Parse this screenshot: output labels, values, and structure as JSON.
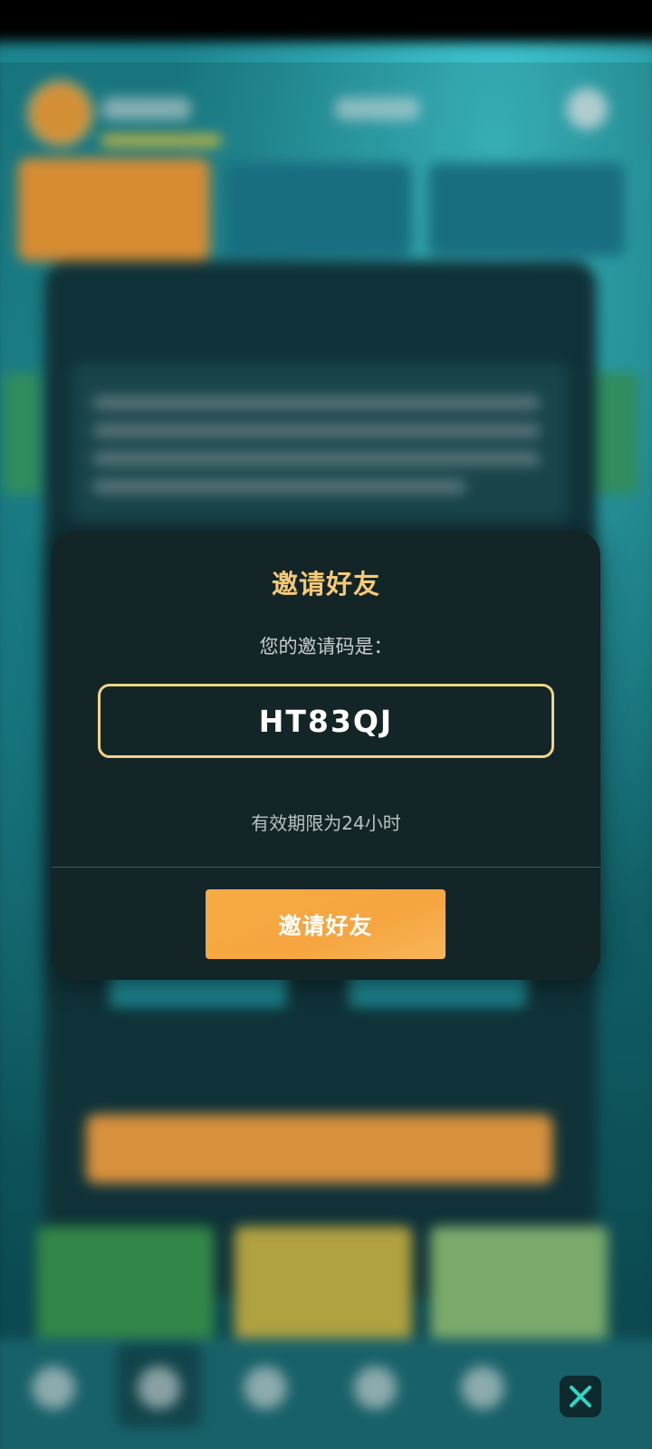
{
  "dialog": {
    "title": "邀请好友",
    "subtitle": "您的邀请码是：",
    "invite_code": "HT83QJ",
    "validity_note": "有效期限为24小时",
    "invite_button_label": "邀请好友"
  },
  "icons": {
    "close": "close-icon"
  },
  "colors": {
    "dialog_background": "#142528",
    "title_gold": "#f6c977",
    "code_border": "#f0d587",
    "button_orange": "#f6a540",
    "close_accent": "#32d4c6"
  }
}
